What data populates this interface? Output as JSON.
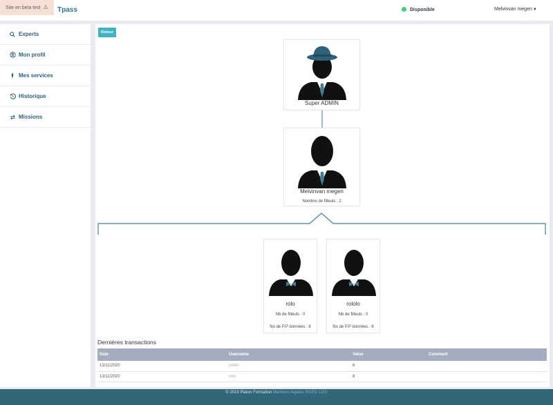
{
  "topbar": {
    "beta_label": "Site en beta test",
    "brand": "Tpass",
    "status_label": "Disponible",
    "status_color": "#3fcf7c",
    "user_name": "Melvinvan megen"
  },
  "sidebar": {
    "items": [
      {
        "label": "Experts",
        "icon": "search-icon"
      },
      {
        "label": "Mon profil",
        "icon": "user-circle-icon"
      },
      {
        "label": "Mes services",
        "icon": "pin-icon"
      },
      {
        "label": "Historique",
        "icon": "history-icon"
      },
      {
        "label": "Missions",
        "icon": "exchange-icon"
      }
    ]
  },
  "main": {
    "back_label": "Retour",
    "root": {
      "name": "Super ADMIN"
    },
    "me": {
      "name": "Melvinvan megen",
      "meta": "Nombre de filleuls : 2"
    },
    "children": [
      {
        "name": "rolo",
        "filleuls": "Nb de filleuls : 0",
        "pp": "No de P.P données : 8"
      },
      {
        "name": "rololo",
        "filleuls": "Nb de filleuls : 0",
        "pp": "No de P.P données : 6"
      }
    ],
    "transactions": {
      "title": "Dernières transactions",
      "headers": [
        "Date",
        "Username",
        "Value",
        "Comment"
      ],
      "rows": [
        {
          "date": "13/11/2020",
          "username": "rololo",
          "value": "6",
          "comment": ""
        },
        {
          "date": "13/11/2020",
          "username": "rolo",
          "value": "8",
          "comment": ""
        }
      ]
    }
  },
  "footer": {
    "copyright": "© 2019 Platon Formation",
    "link1": "Mentions légales",
    "link2": "RGPD",
    "link3": "CGV"
  },
  "colors": {
    "accent": "#3fb3c4",
    "sidebar_text": "#2f5f7a",
    "footer_bg": "#32677a",
    "table_header": "#a4adbf",
    "tie": "#3e7f93"
  }
}
